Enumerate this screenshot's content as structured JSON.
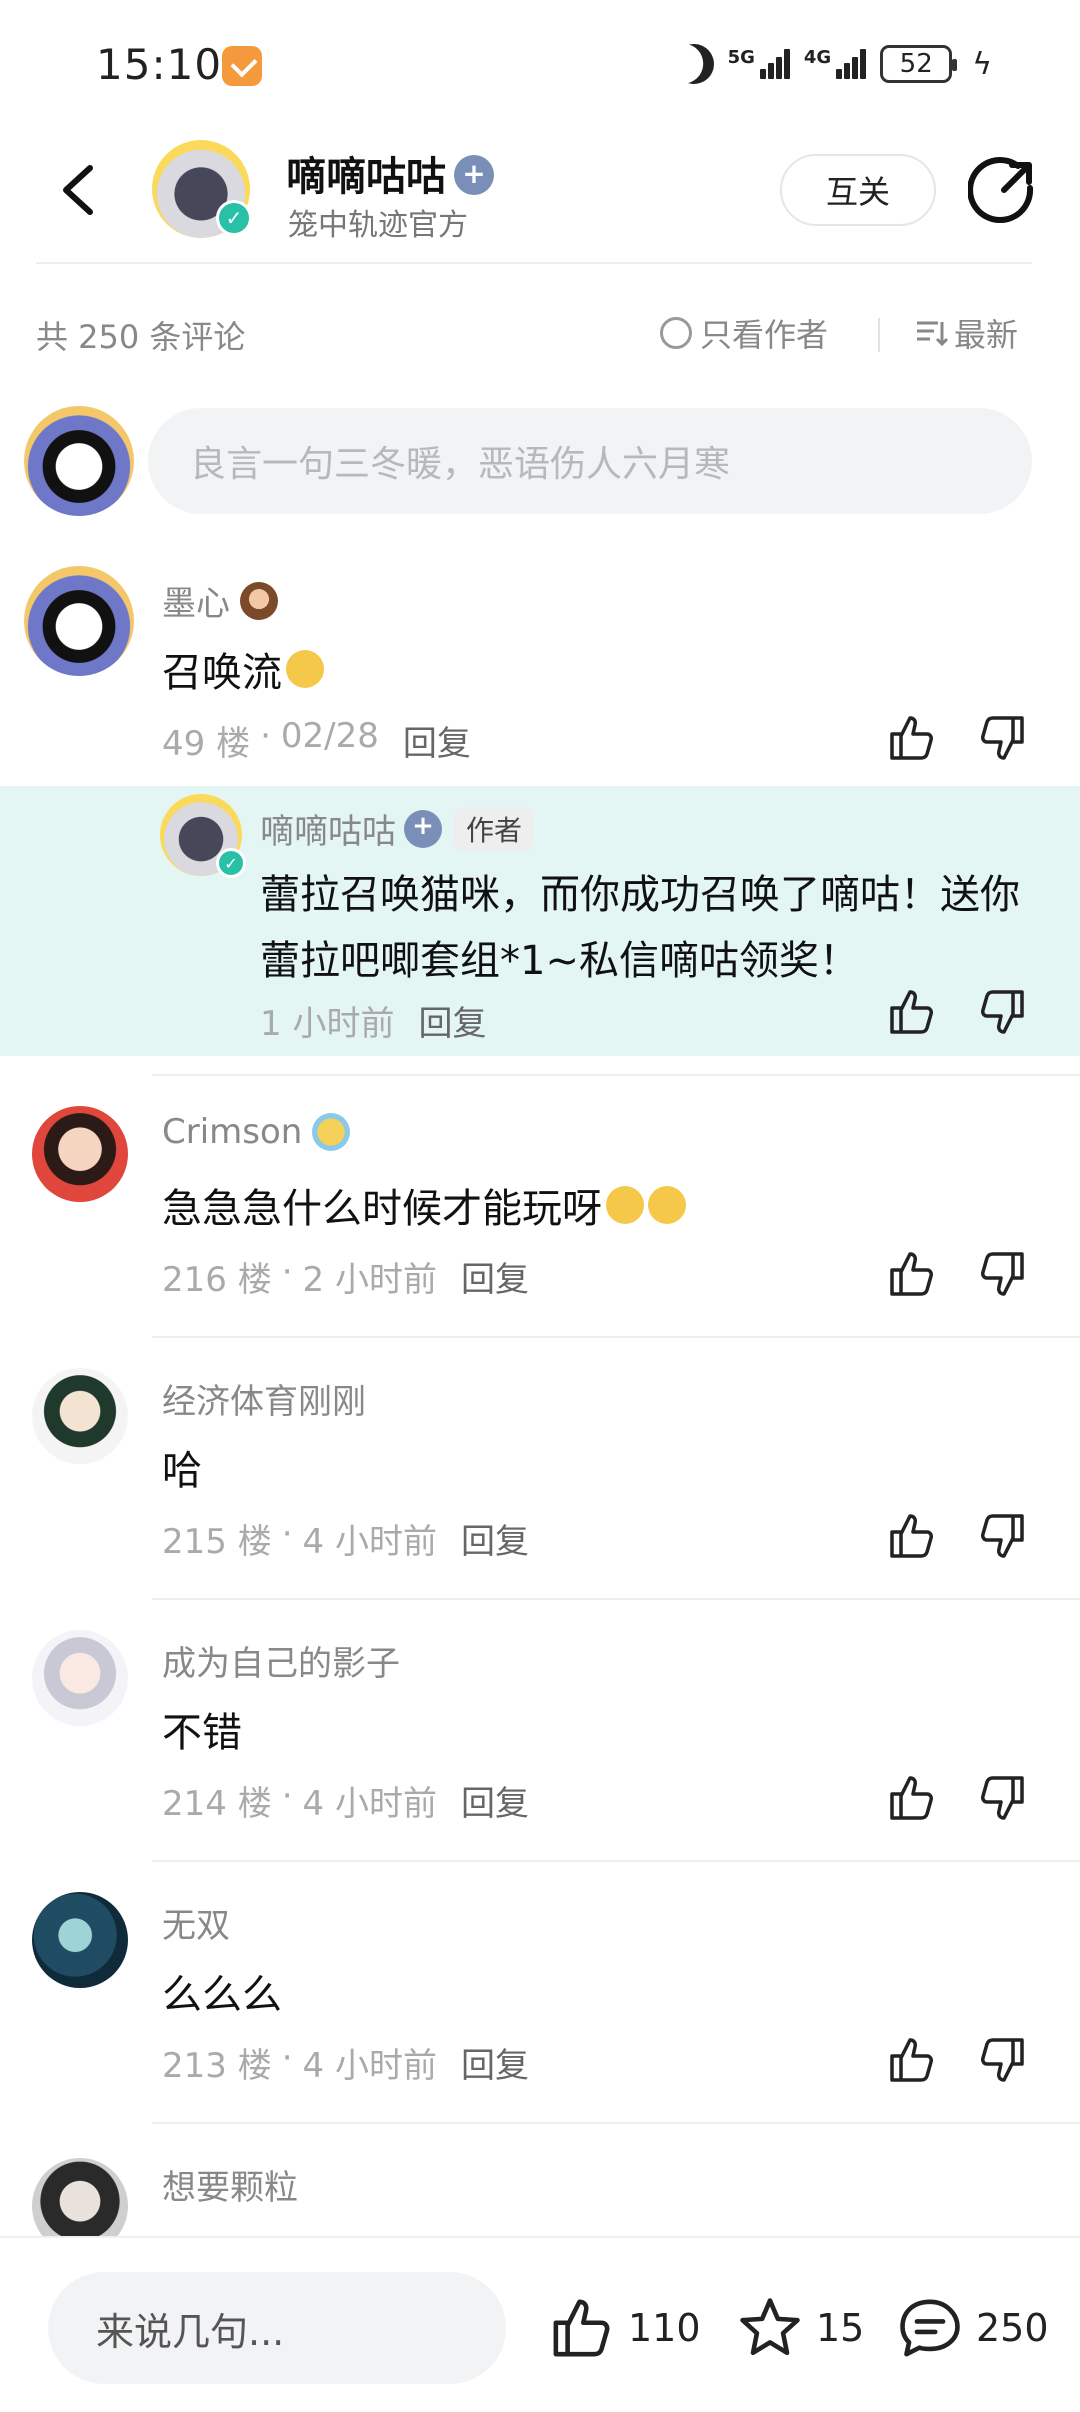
{
  "status_bar": {
    "time": "15:10",
    "battery": "52",
    "net1": "5G",
    "net2": "4G"
  },
  "header": {
    "title": "嘀嘀咕咕",
    "subtitle": "笼中轨迹官方",
    "mutual_label": "互关"
  },
  "sort": {
    "total": "共 250 条评论",
    "only_author": "只看作者",
    "latest": "最新"
  },
  "input": {
    "placeholder": "良言一句三冬暖，恶语伤人六月寒"
  },
  "comments": [
    {
      "user": "墨心",
      "text": "召唤流",
      "floor": "49 楼",
      "time": "02/28",
      "reply": "回复"
    },
    {
      "user": "Crimson",
      "text": "急急急什么时候才能玩呀",
      "floor": "216 楼",
      "time": "2 小时前",
      "reply": "回复"
    },
    {
      "user": "经济体育刚刚",
      "text": "哈",
      "floor": "215 楼",
      "time": "4 小时前",
      "reply": "回复"
    },
    {
      "user": "成为自己的影子",
      "text": "不错",
      "floor": "214 楼",
      "time": "4 小时前",
      "reply": "回复"
    },
    {
      "user": "无双",
      "text": "么么么",
      "floor": "213 楼",
      "time": "4 小时前",
      "reply": "回复"
    },
    {
      "user": "想要颗粒",
      "text": "",
      "floor": "",
      "time": "",
      "reply": ""
    }
  ],
  "author_reply": {
    "user": "嘀嘀咕咕",
    "tag": "作者",
    "text": "蕾拉召唤猫咪，而你成功召唤了嘀咕！送你蕾拉吧唧套组*1~私信嘀咕领奖！",
    "time": "1 小时前",
    "reply": "回复"
  },
  "bottom_bar": {
    "placeholder": "来说几句...",
    "likes": "110",
    "favorites": "15",
    "comments": "250"
  },
  "colors": {
    "reply_bg": "#e3f6f3",
    "verify": "#27c1a8",
    "badge": "#7a8fb8"
  }
}
